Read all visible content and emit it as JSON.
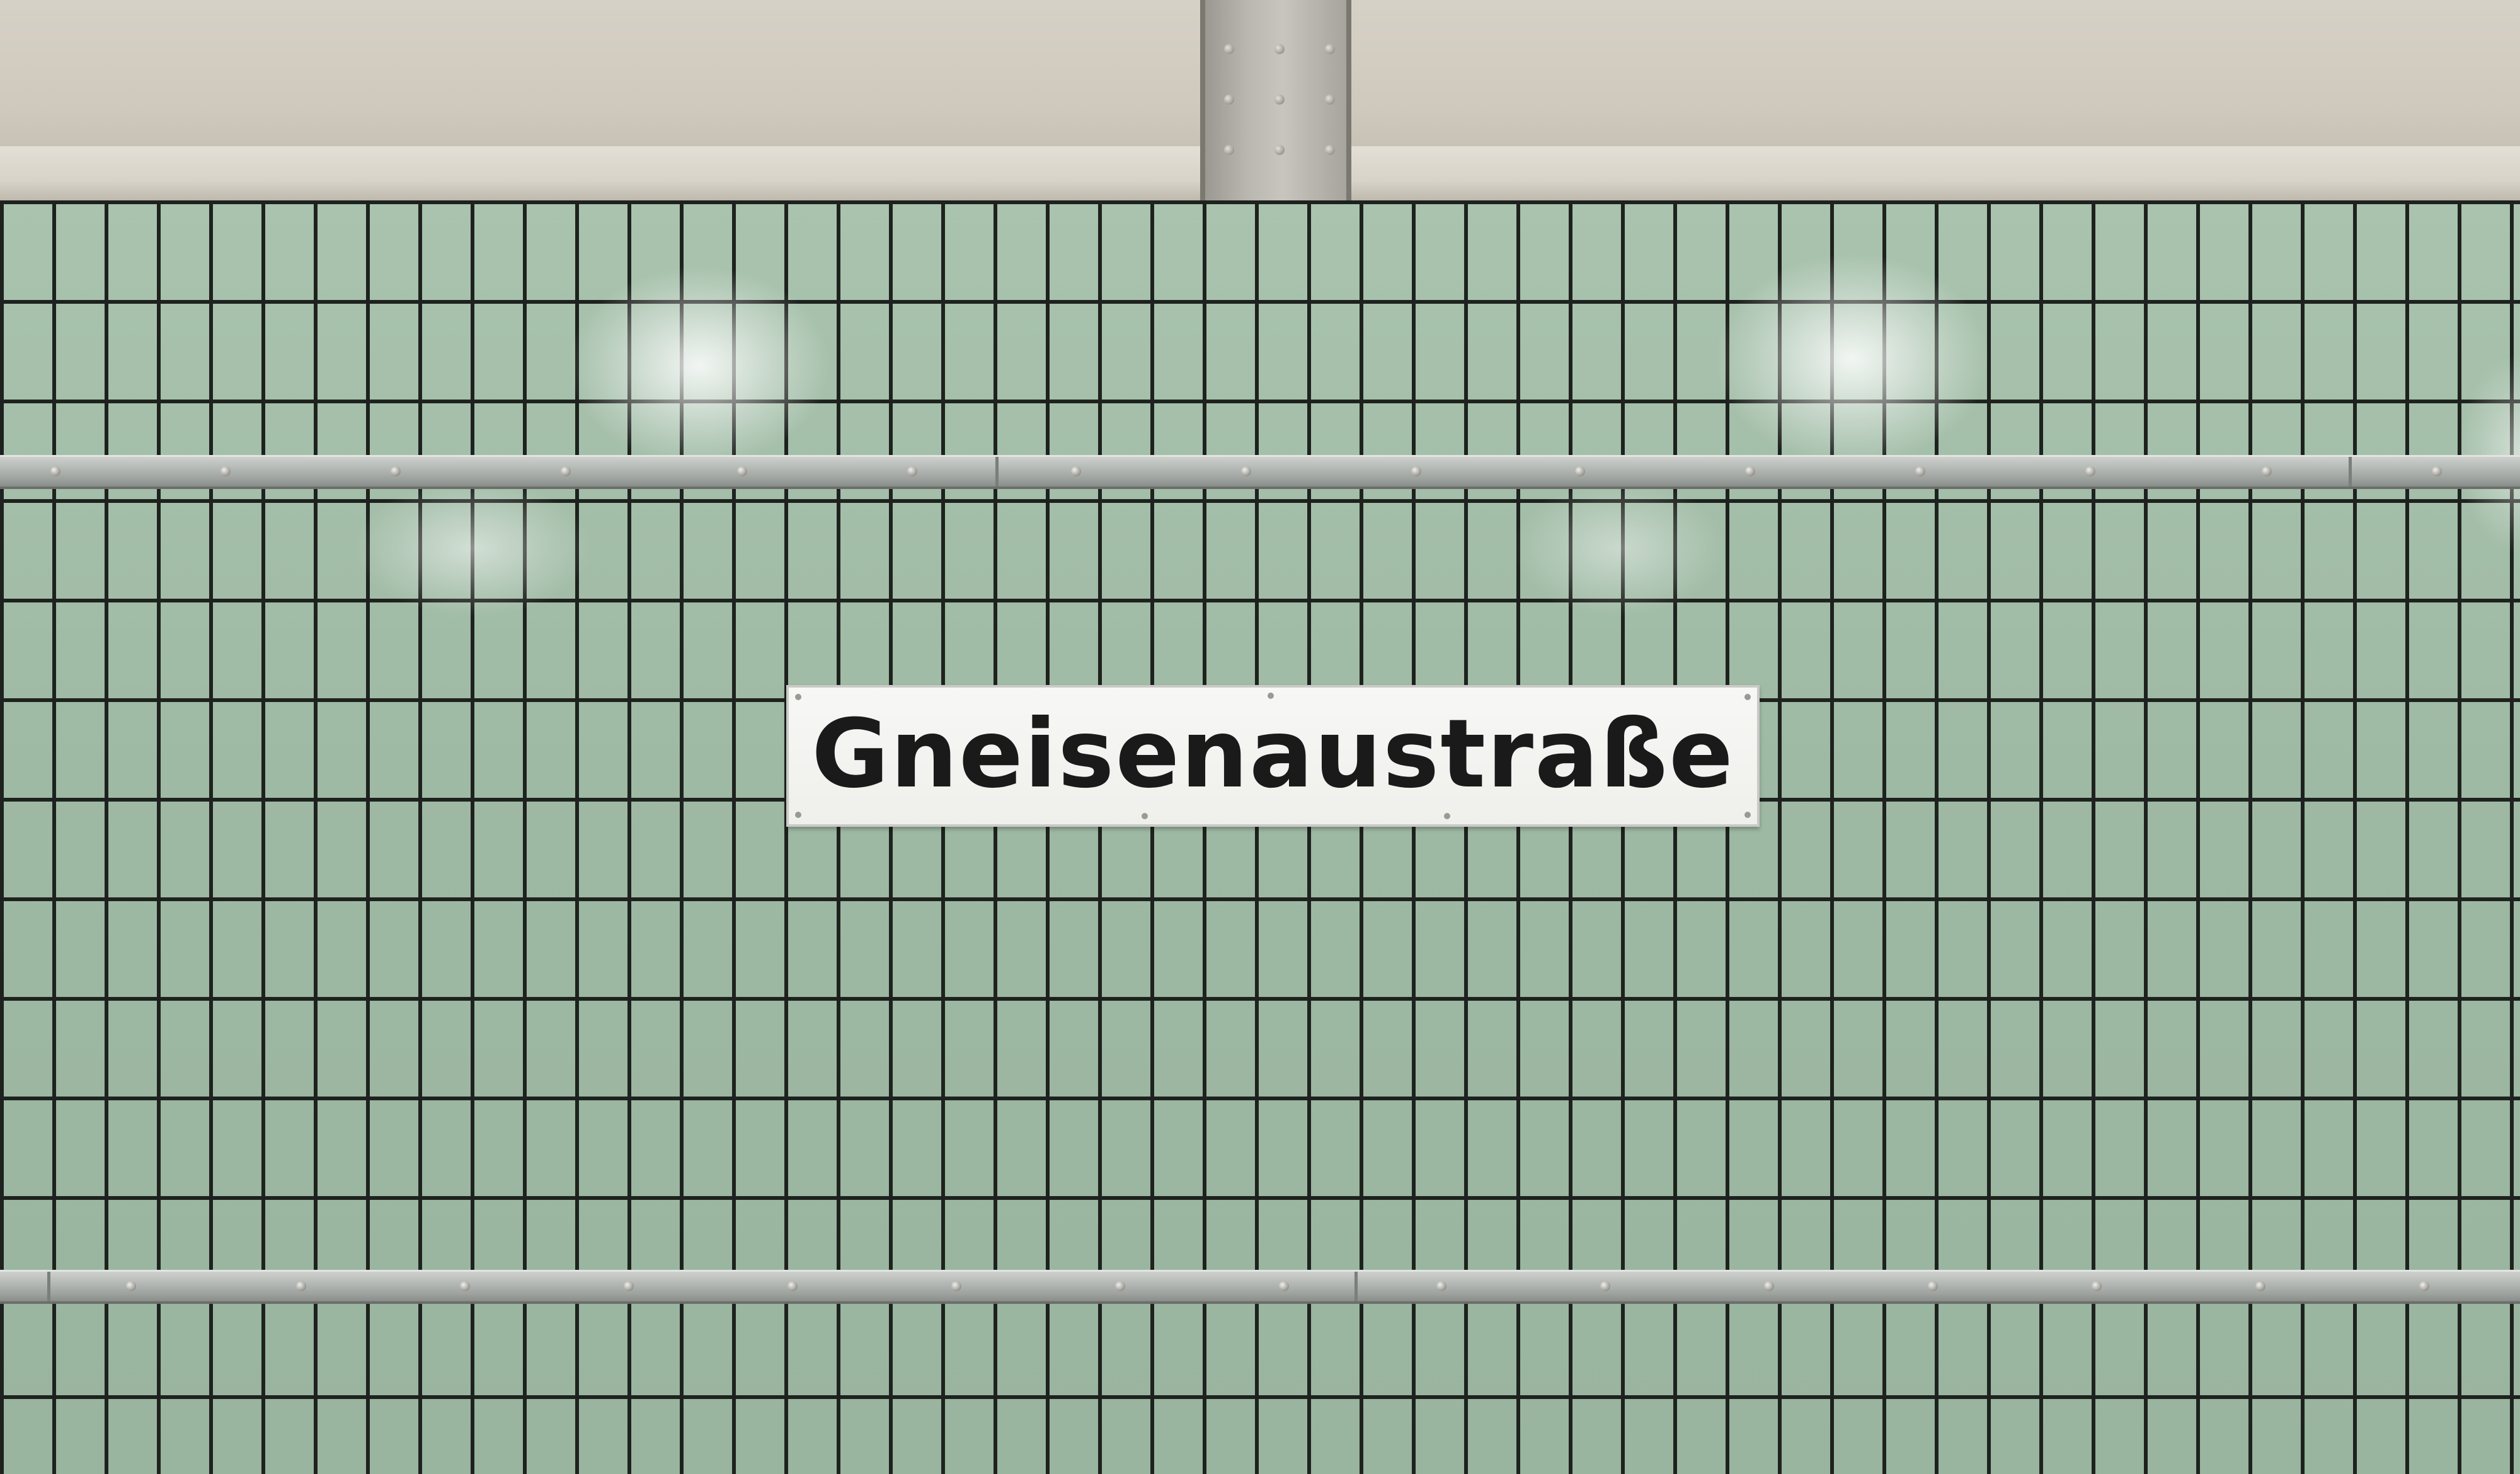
{
  "station_sign": {
    "name": "Gneisenaustraße"
  },
  "colors": {
    "tile": "#9fbaa5",
    "grout": "#1e221e",
    "sign_background": "#f7f7f5",
    "sign_text": "#1a1a1a",
    "ceiling": "#d6d1c6",
    "rail": "#b4b8b4"
  }
}
